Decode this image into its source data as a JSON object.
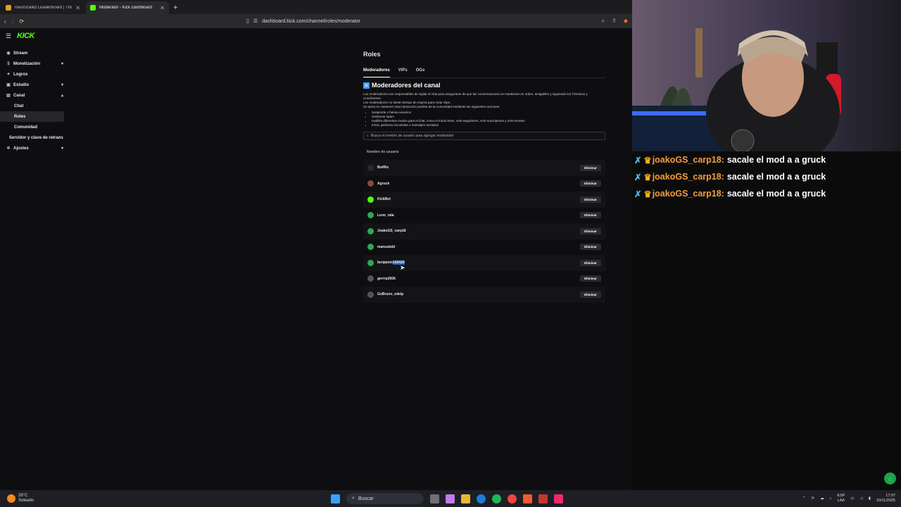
{
  "browser": {
    "tabs": [
      {
        "title": "meurocalkd LeaderBoard | The best ...",
        "active": false
      },
      {
        "title": "Moderator - Kick Dashboard",
        "active": true
      }
    ],
    "url": "dashboard.kick.com/channel/roles/moderator"
  },
  "sidebar": {
    "logo": "KICK",
    "items": [
      {
        "label": "Stream",
        "icon": "broadcast-icon",
        "chevron": ""
      },
      {
        "label": "Monetización",
        "icon": "dollar-icon",
        "chevron": "⌄"
      },
      {
        "label": "Logros",
        "icon": "trophy-icon",
        "chevron": ""
      },
      {
        "label": "Estudio",
        "icon": "studio-icon",
        "chevron": "⌄"
      },
      {
        "label": "Canal",
        "icon": "channel-icon",
        "chevron": "⌃"
      }
    ],
    "sub_items": [
      "Chat",
      "Roles",
      "Comunidad"
    ],
    "extra_items": [
      {
        "label": "Servidor y clave de retrans",
        "icon": ""
      },
      {
        "label": "Ajustes",
        "icon": "gear-icon",
        "chevron": "⌄"
      }
    ]
  },
  "main": {
    "title": "Roles",
    "tabs": [
      "Moderadores",
      "VIPs",
      "OGs"
    ],
    "section_title": "Moderadores del canal",
    "desc_lines": [
      "Los moderadores son responsables de vigilar el chat para asegurarse de que las conversaciones se mantienen en orden, amigables y siguiendo los Términos y Condiciones.",
      "Los moderadores no tienen tiempo de espera para crear clips.",
      "Su tarea es mantener una interacción positiva de la comunidad mediante las siguientes acciones:"
    ],
    "bullets": [
      "Suspende o banea usuarios",
      "Gestionar spam",
      "Habilita diferentes modos para el chat, como el modo lento, solo-seguidores, solo-suscriptores y solo-emotes",
      "Inicia, gestiona encuestas o mensajes anclados"
    ],
    "search_placeholder": "Busca el nombre de usuario para agregar moderador",
    "column_header": "Nombre de usuario",
    "remove_label": "Eliminar",
    "moderators": [
      {
        "name": "BotRix",
        "name_suffix": "",
        "avatar_color": "#2a2a2d"
      },
      {
        "name": "Agruck",
        "name_suffix": "",
        "avatar_color": "#8a4a3a"
      },
      {
        "name": "KickBot",
        "name_suffix": "",
        "avatar_color": "#53fc18"
      },
      {
        "name": "Leoo_rala",
        "name_suffix": "",
        "avatar_color": "#2fa84f"
      },
      {
        "name": "JoakoGS_carp18",
        "name_suffix": "",
        "avatar_color": "#2fa84f"
      },
      {
        "name": "manuskdd",
        "name_suffix": "",
        "avatar_color": "#2fa84f"
      },
      {
        "name": "benjamin",
        "name_suffix": "143420",
        "avatar_color": "#2fa84f"
      },
      {
        "name": "gerrrp2606",
        "name_suffix": "",
        "avatar_color": "#555559"
      },
      {
        "name": "GsBruno_edeip",
        "name_suffix": "",
        "avatar_color": "#555559"
      }
    ]
  },
  "chat": {
    "messages": [
      {
        "user": "joakoGS_carp18:",
        "text": "sacale el mod a a gruck"
      },
      {
        "user": "joakoGS_carp18:",
        "text": "sacale el mod a a gruck"
      },
      {
        "user": "joakoGS_carp18:",
        "text": "sacale el mod a a gruck"
      }
    ]
  },
  "taskbar": {
    "temp": "26°C",
    "weather": "Soleado",
    "search": "Buscar",
    "lang_top": "ESP",
    "lang_bottom": "LAA",
    "time": "17:07",
    "date": "10/11/2025"
  },
  "colors": {
    "kick_green": "#53fc18",
    "chat_user": "#f49d3c",
    "crown": "#f5b21a"
  }
}
